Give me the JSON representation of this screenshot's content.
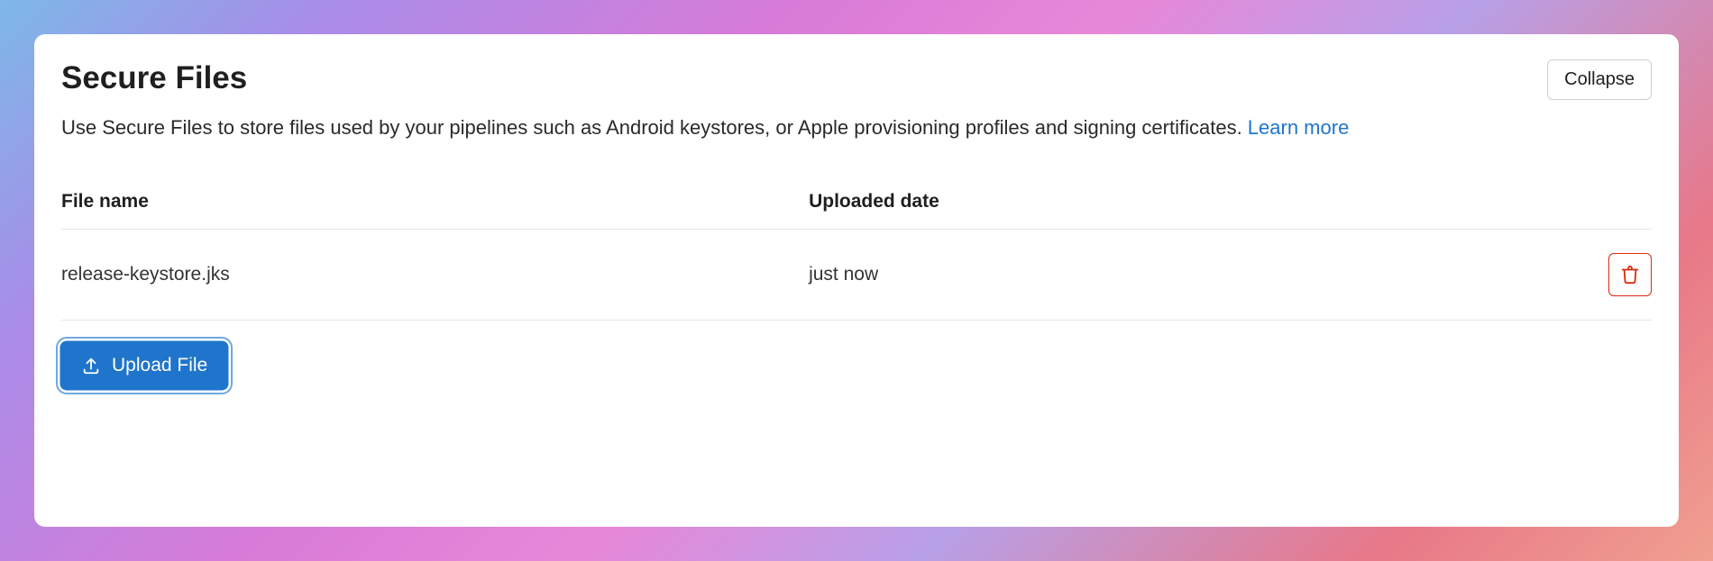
{
  "header": {
    "title": "Secure Files",
    "collapse_label": "Collapse"
  },
  "description": {
    "text": "Use Secure Files to store files used by your pipelines such as Android keystores, or Apple provisioning profiles and signing certificates. ",
    "learn_more": "Learn more"
  },
  "table": {
    "columns": {
      "file_name": "File name",
      "uploaded_date": "Uploaded date"
    },
    "rows": [
      {
        "file_name": "release-keystore.jks",
        "uploaded_date": "just now"
      }
    ]
  },
  "actions": {
    "upload_label": "Upload File"
  }
}
